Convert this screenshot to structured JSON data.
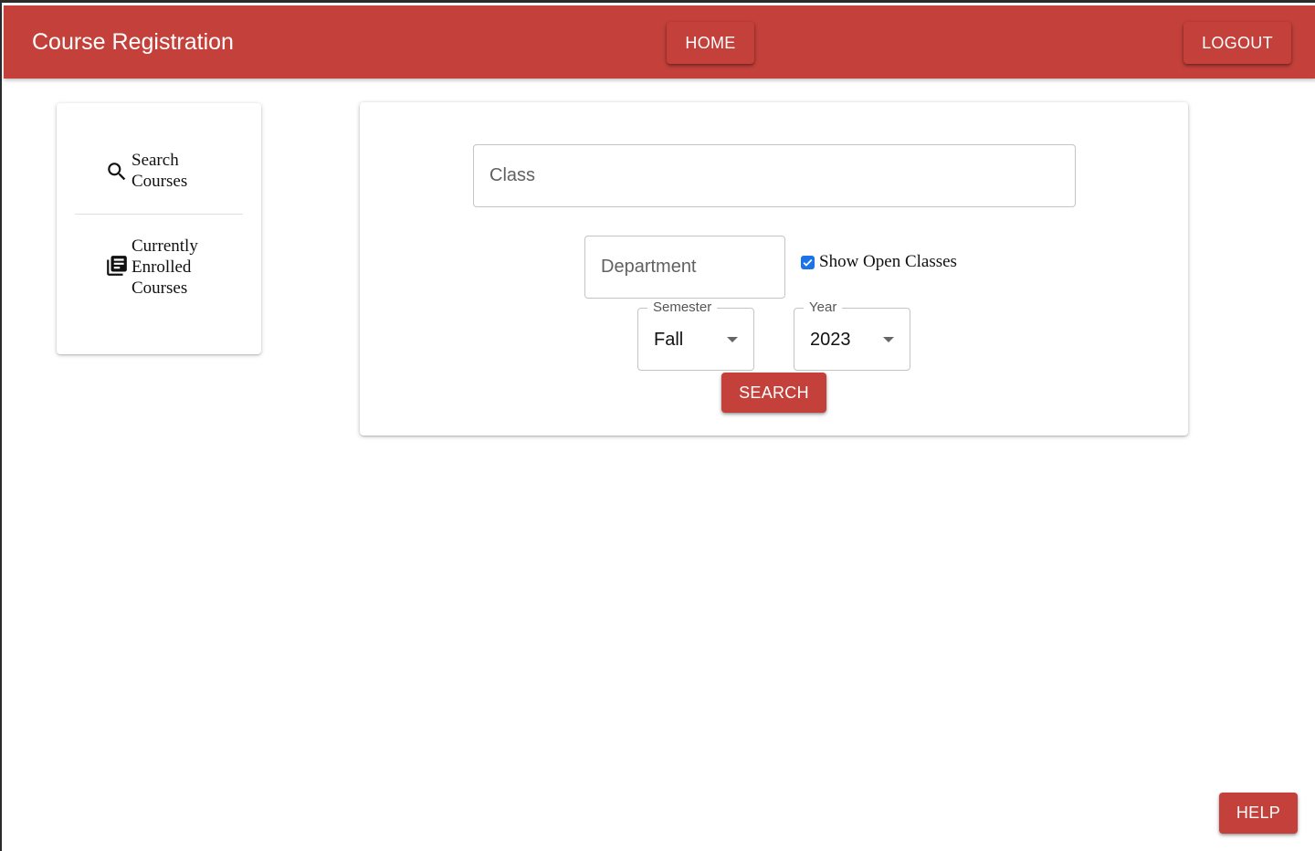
{
  "header": {
    "title": "Course Registration",
    "home_label": "HOME",
    "logout_label": "LOGOUT"
  },
  "sidebar": {
    "items": [
      {
        "label": "Search Courses",
        "icon": "search-icon"
      },
      {
        "label": "Currently Enrolled Courses",
        "icon": "library-books-icon"
      }
    ]
  },
  "search_form": {
    "class_placeholder": "Class",
    "department_placeholder": "Department",
    "show_open_label": "Show Open Classes",
    "show_open_checked": true,
    "semester_label": "Semester",
    "semester_value": "Fall",
    "year_label": "Year",
    "year_value": "2023",
    "search_label": "SEARCH"
  },
  "help_label": "HELP",
  "colors": {
    "primary": "#c4403a",
    "checkbox": "#1a73e8",
    "text": "#111111"
  }
}
